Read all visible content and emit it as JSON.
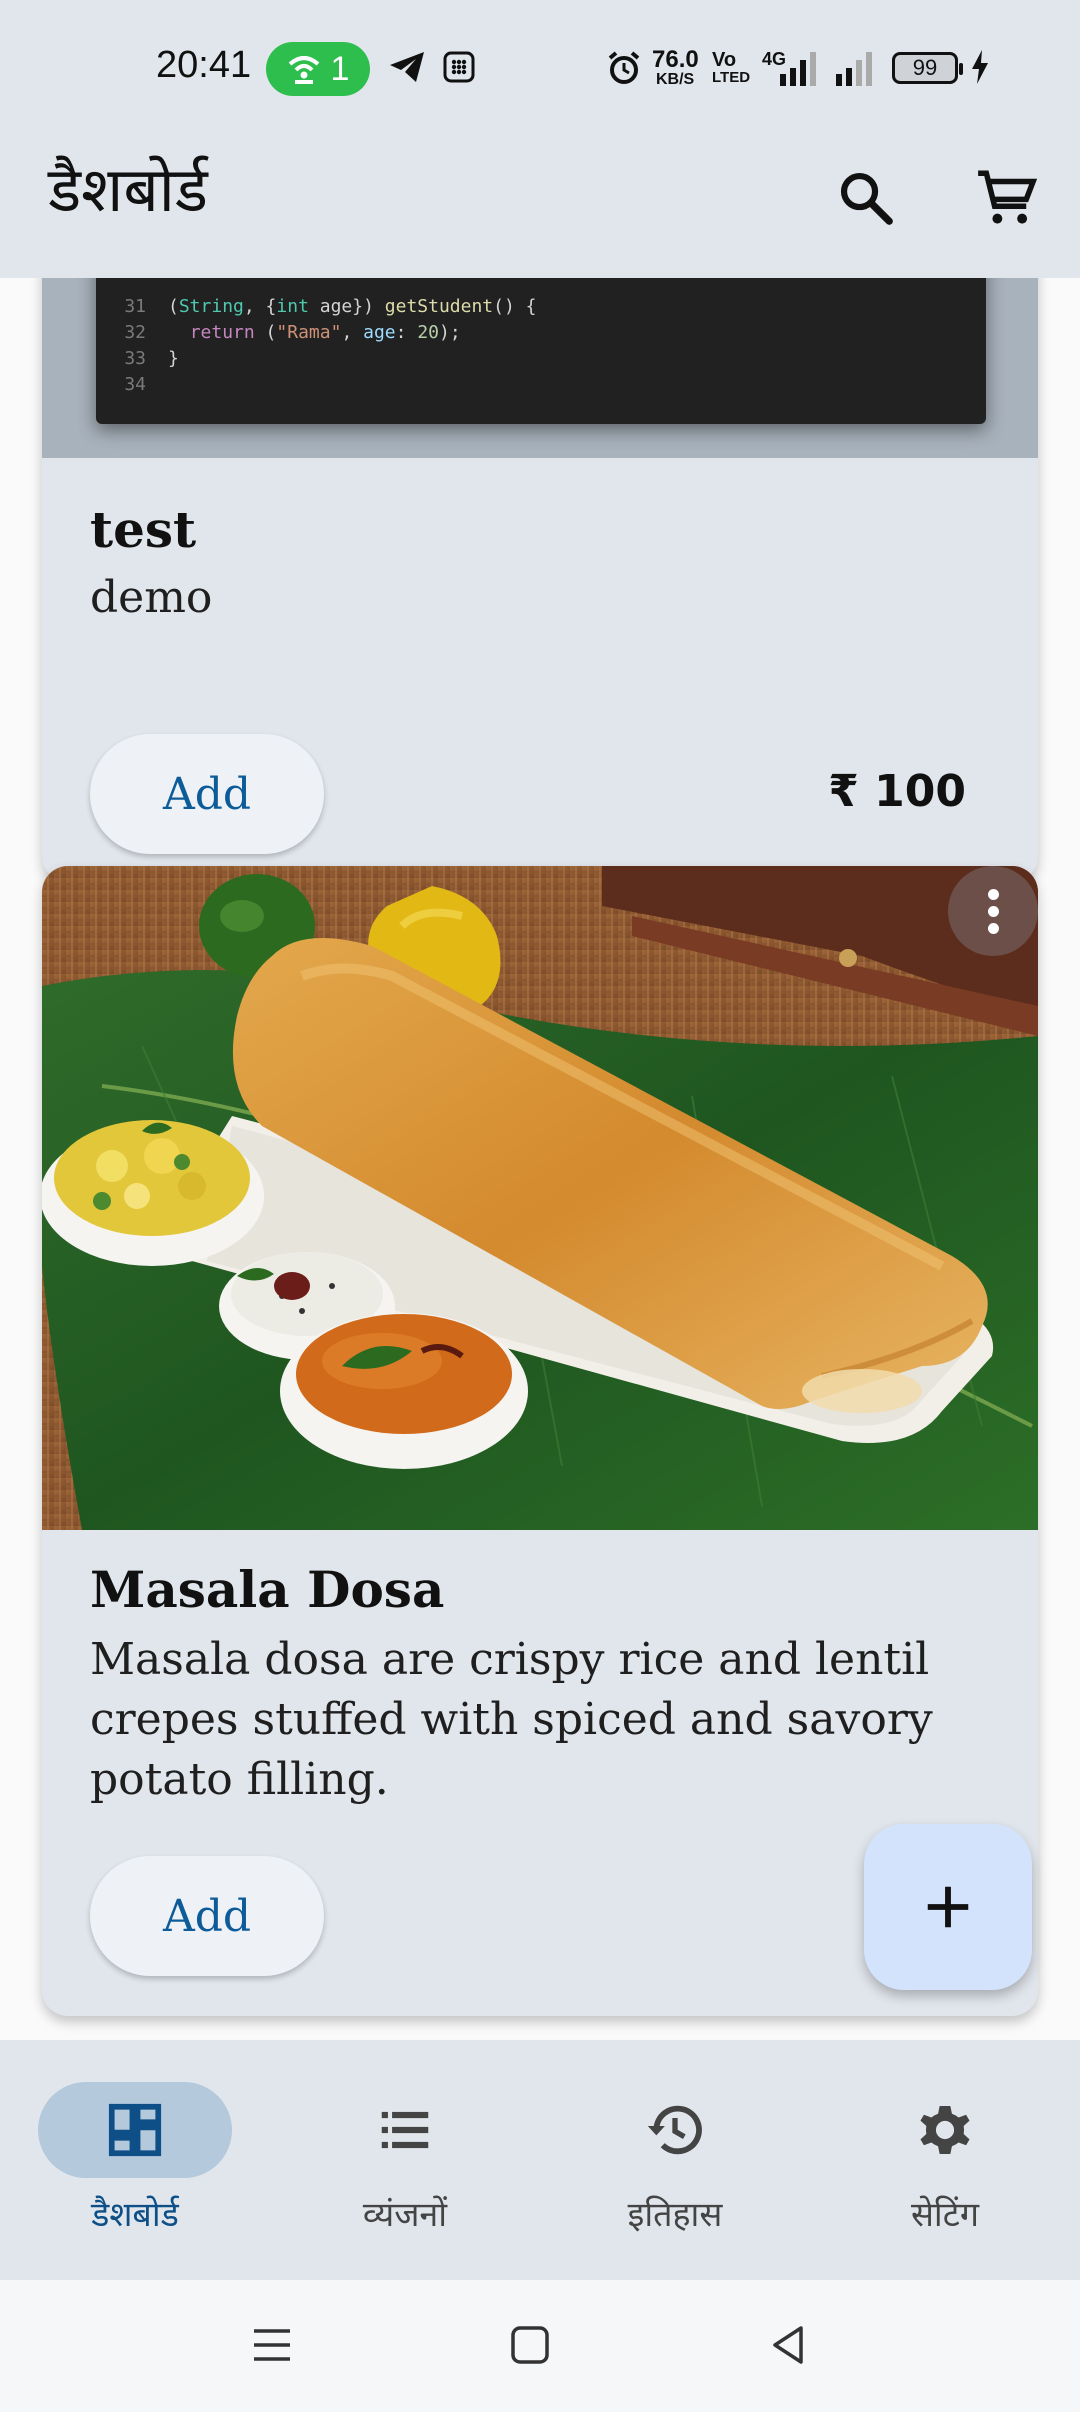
{
  "status_bar": {
    "time": "20:41",
    "hotspot_count": "1",
    "net_speed": "76.0",
    "net_unit": "KB/S",
    "volte_line1": "Vo",
    "volte_line2": "LTED",
    "network_type": "4G",
    "battery": "99"
  },
  "app_bar": {
    "title": "डैशबोर्ड"
  },
  "items": [
    {
      "code_lines": [
        {
          "num": "31"
        },
        {
          "num": "32"
        },
        {
          "num": "33"
        },
        {
          "num": "34"
        }
      ],
      "code_text": {
        "l31_open": "(",
        "l31_type1": "String",
        "l31_mid": ", {",
        "l31_type2": "int",
        "l31_rest": " age}) ",
        "l31_fn": "getStudent",
        "l31_end": "() {",
        "l32_ret": "return",
        "l32_open": " (",
        "l32_str": "\"Rama\"",
        "l32_sep": ", ",
        "l32_var": "age",
        "l32_colon": ": ",
        "l32_num": "20",
        "l32_end": ");",
        "l33": "}"
      },
      "title": "test",
      "description": "demo",
      "add_label": "Add",
      "price": "₹ 100"
    },
    {
      "title": "Masala Dosa",
      "description": "Masala dosa are crispy rice and lentil crepes stuffed with spiced and savory potato filling.",
      "add_label": "Add"
    }
  ],
  "bottom_nav": [
    {
      "label": "डैशबोर्ड",
      "icon": "dashboard-icon",
      "active": true
    },
    {
      "label": "व्यंजनों",
      "icon": "list-icon",
      "active": false
    },
    {
      "label": "इतिहास",
      "icon": "history-icon",
      "active": false
    },
    {
      "label": "सेटिंग",
      "icon": "settings-icon",
      "active": false
    }
  ],
  "colors": {
    "surface": "#e1e6ec",
    "accent": "#0d4f86",
    "fab": "#d2e3fb",
    "active_pill": "#b4c9dc"
  }
}
